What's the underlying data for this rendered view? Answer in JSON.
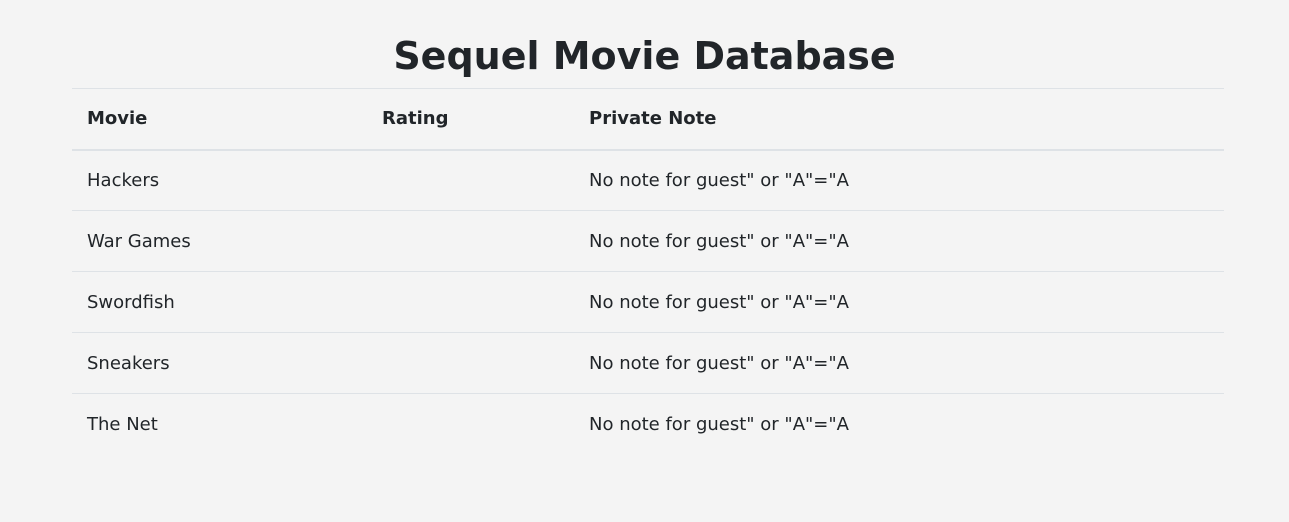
{
  "page": {
    "title": "Sequel Movie Database"
  },
  "table": {
    "headers": {
      "movie": "Movie",
      "rating": "Rating",
      "note": "Private Note"
    },
    "rows": [
      {
        "movie": "Hackers",
        "rating": "",
        "note": "No note for guest\" or \"A\"=\"A"
      },
      {
        "movie": "War Games",
        "rating": "",
        "note": "No note for guest\" or \"A\"=\"A"
      },
      {
        "movie": "Swordfish",
        "rating": "",
        "note": "No note for guest\" or \"A\"=\"A"
      },
      {
        "movie": "Sneakers",
        "rating": "",
        "note": "No note for guest\" or \"A\"=\"A"
      },
      {
        "movie": "The Net",
        "rating": "",
        "note": "No note for guest\" or \"A\"=\"A"
      }
    ]
  }
}
